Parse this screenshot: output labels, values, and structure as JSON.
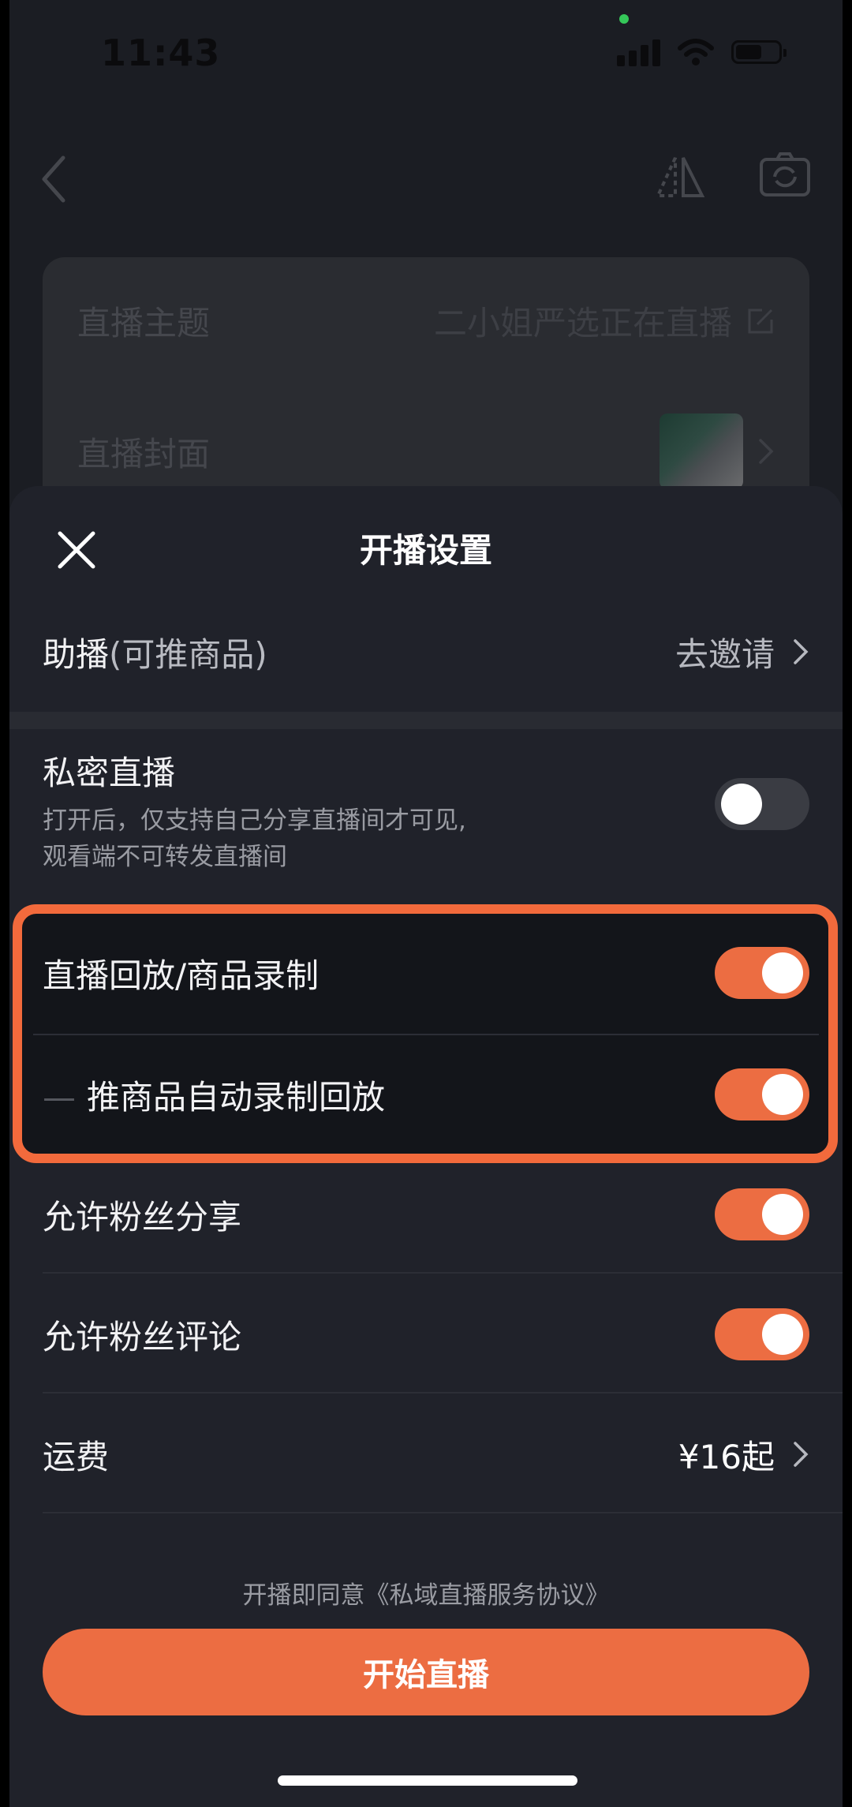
{
  "status_bar": {
    "time": "11:43"
  },
  "background_page": {
    "topic_label": "直播主题",
    "topic_value": "二小姐严选正在直播",
    "cover_label": "直播封面"
  },
  "sheet": {
    "title": "开播设置",
    "assistant": {
      "label": "助播",
      "suffix": "(可推商品)",
      "action": "去邀请"
    },
    "private_live": {
      "label": "私密直播",
      "desc_line1": "打开后，仅支持自己分享直播间才可见,",
      "desc_line2": "观看端不可转发直播间",
      "enabled": false
    },
    "replay": {
      "label": "直播回放/商品录制",
      "enabled": true
    },
    "auto_record": {
      "label": "推商品自动录制回放",
      "enabled": true
    },
    "allow_share": {
      "label": "允许粉丝分享",
      "enabled": true
    },
    "allow_comment": {
      "label": "允许粉丝评论",
      "enabled": true
    },
    "shipping": {
      "label": "运费",
      "value": "¥16起"
    },
    "agreement": "开播即同意《私域直播服务协议》",
    "start_button": "开始直播"
  },
  "colors": {
    "accent": "#ec6d42",
    "highlight": "#f26a3c",
    "sheet_bg": "#20222a"
  }
}
